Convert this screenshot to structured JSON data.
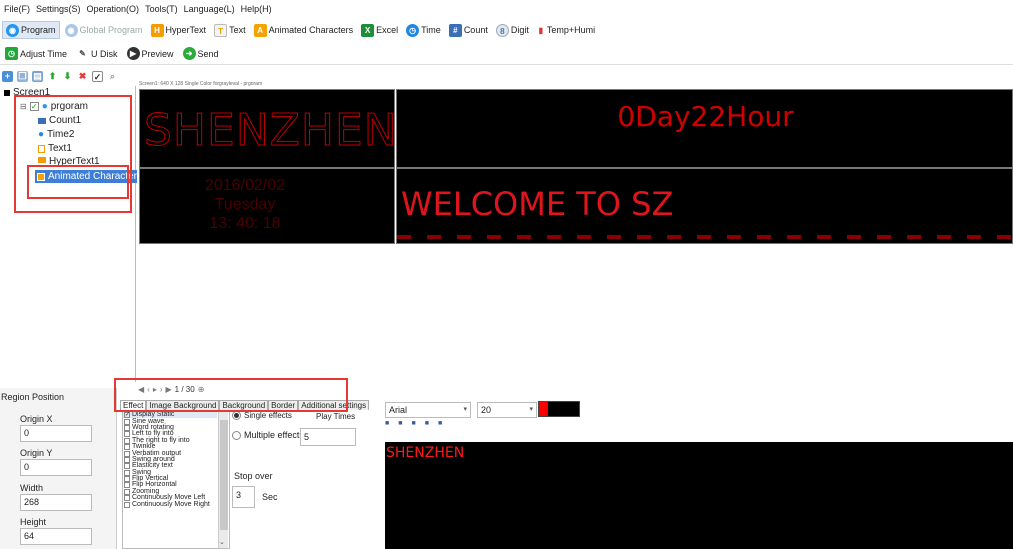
{
  "menu": [
    "File(F)",
    "Settings(S)",
    "Operation(O)",
    "Tools(T)",
    "Language(L)",
    "Help(H)"
  ],
  "toolbar1": {
    "program": "Program",
    "global_program": "Global Program",
    "hypertext": "HyperText",
    "text": "Text",
    "animated_characters": "Animated Characters",
    "excel": "Excel",
    "time": "Time",
    "count": "Count",
    "digit": "Digit",
    "temp_humi": "Temp+Humi"
  },
  "toolbar2": {
    "adjust_time": "Adjust Time",
    "u_disk": "U Disk",
    "preview": "Preview",
    "send": "Send"
  },
  "tree": {
    "screen": "Screen1",
    "program": "prgoram",
    "count": "Count1",
    "time": "Time2",
    "text": "Text1",
    "hypertext": "HyperText1",
    "animated": "Animated Characters1"
  },
  "canvas": {
    "title": "Screen1: 640 X 128  Single Color forgrayleval - prgoram",
    "region_shenzhen": "SHENZHEN",
    "region_count": "0Day22Hour",
    "time_date": "2016/02/02",
    "time_day": "Tuesday",
    "time_clock": "13: 40: 18",
    "region_welcome": "WELCOME TO SZ"
  },
  "nav": {
    "page": "1 / 30"
  },
  "region": {
    "header": "Region Position",
    "origin_x_label": "Origin X",
    "origin_x": "0",
    "origin_y_label": "Origin Y",
    "origin_y": "0",
    "width_label": "Width",
    "width": "268",
    "height_label": "Height",
    "height": "64"
  },
  "effect": {
    "tabs": [
      "Effect",
      "Image Background",
      "Background",
      "Border",
      "Additional settings"
    ],
    "list": [
      {
        "label": "Display Static",
        "checked": true
      },
      {
        "label": "Sine wave",
        "checked": false
      },
      {
        "label": "Word rotating",
        "checked": false
      },
      {
        "label": "Left to fly into",
        "checked": false
      },
      {
        "label": "The right to fly into",
        "checked": false
      },
      {
        "label": "Twinkle",
        "checked": false
      },
      {
        "label": "Verbatim output",
        "checked": false
      },
      {
        "label": "Swing around",
        "checked": false
      },
      {
        "label": "Elasticity text",
        "checked": false
      },
      {
        "label": "Swing",
        "checked": false
      },
      {
        "label": "Flip Vertical",
        "checked": false
      },
      {
        "label": "Flip Horizontal",
        "checked": false
      },
      {
        "label": "Zooming",
        "checked": false
      },
      {
        "label": "Continuously Move Left",
        "checked": false
      },
      {
        "label": "Continuously Move Right",
        "checked": false
      }
    ],
    "single_effects": "Single effects",
    "play_times_label": "Play Times",
    "multiple_effects": "Multiple effects",
    "play_times": "5",
    "stop_over_label": "Stop over",
    "stop_over": "3",
    "sec_label": "Sec"
  },
  "text_panel": {
    "font": "Arial",
    "size": "20",
    "fg_color": "#ff0000",
    "bg_color": "#000000",
    "preview_text": "SHENZHEN"
  },
  "colors": {
    "highlight": "#e53935",
    "led_text": "#c00000",
    "led_bright": "#ff1a1a"
  }
}
